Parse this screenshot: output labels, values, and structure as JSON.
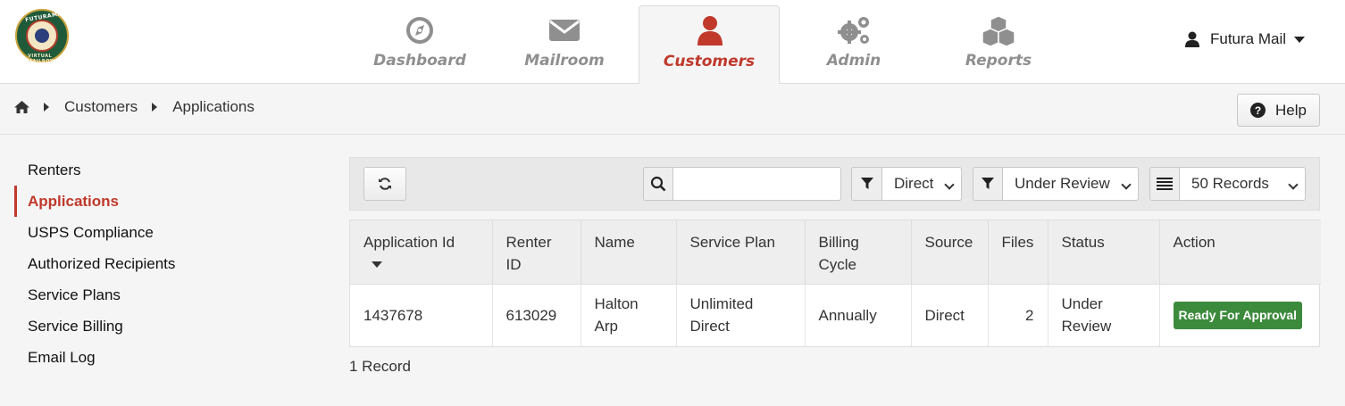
{
  "app": {
    "logo_alt": "FUTURAMAIL VIRTUAL MAILBOX",
    "logo_top": "FUTURAMAIL",
    "logo_bottom": "VIRTUAL MAILBOX"
  },
  "nav": {
    "tabs": [
      {
        "label": "Dashboard",
        "icon": "compass-icon",
        "active": false
      },
      {
        "label": "Mailroom",
        "icon": "envelope-icon",
        "active": false
      },
      {
        "label": "Customers",
        "icon": "user-icon",
        "active": true
      },
      {
        "label": "Admin",
        "icon": "gears-icon",
        "active": false
      },
      {
        "label": "Reports",
        "icon": "cubes-icon",
        "active": false
      }
    ],
    "user_name": "Futura Mail"
  },
  "breadcrumb": {
    "items": [
      "Customers",
      "Applications"
    ]
  },
  "help_label": "Help",
  "sidebar": {
    "items": [
      {
        "label": "Renters",
        "active": false
      },
      {
        "label": "Applications",
        "active": true
      },
      {
        "label": "USPS Compliance",
        "active": false
      },
      {
        "label": "Authorized Recipients",
        "active": false
      },
      {
        "label": "Service Plans",
        "active": false
      },
      {
        "label": "Service Billing",
        "active": false
      },
      {
        "label": "Email Log",
        "active": false
      }
    ]
  },
  "toolbar": {
    "search_value": "",
    "source_filter": "Direct",
    "status_filter": "Under Review",
    "page_size": "50 Records"
  },
  "table": {
    "columns": [
      "Application Id",
      "Renter ID",
      "Name",
      "Service Plan",
      "Billing Cycle",
      "Source",
      "Files",
      "Status",
      "Action"
    ],
    "rows": [
      {
        "application_id": "1437678",
        "renter_id": "613029",
        "name": "Halton Arp",
        "service_plan": "Unlimited Direct",
        "billing_cycle": "Annually",
        "source": "Direct",
        "files": "2",
        "status": "Under Review",
        "action": "Ready For Approval"
      }
    ]
  },
  "record_count": "1 Record",
  "colors": {
    "accent": "#c0392b",
    "nav_inactive": "#8f8f8f",
    "badge_green": "#3c8a3c"
  }
}
